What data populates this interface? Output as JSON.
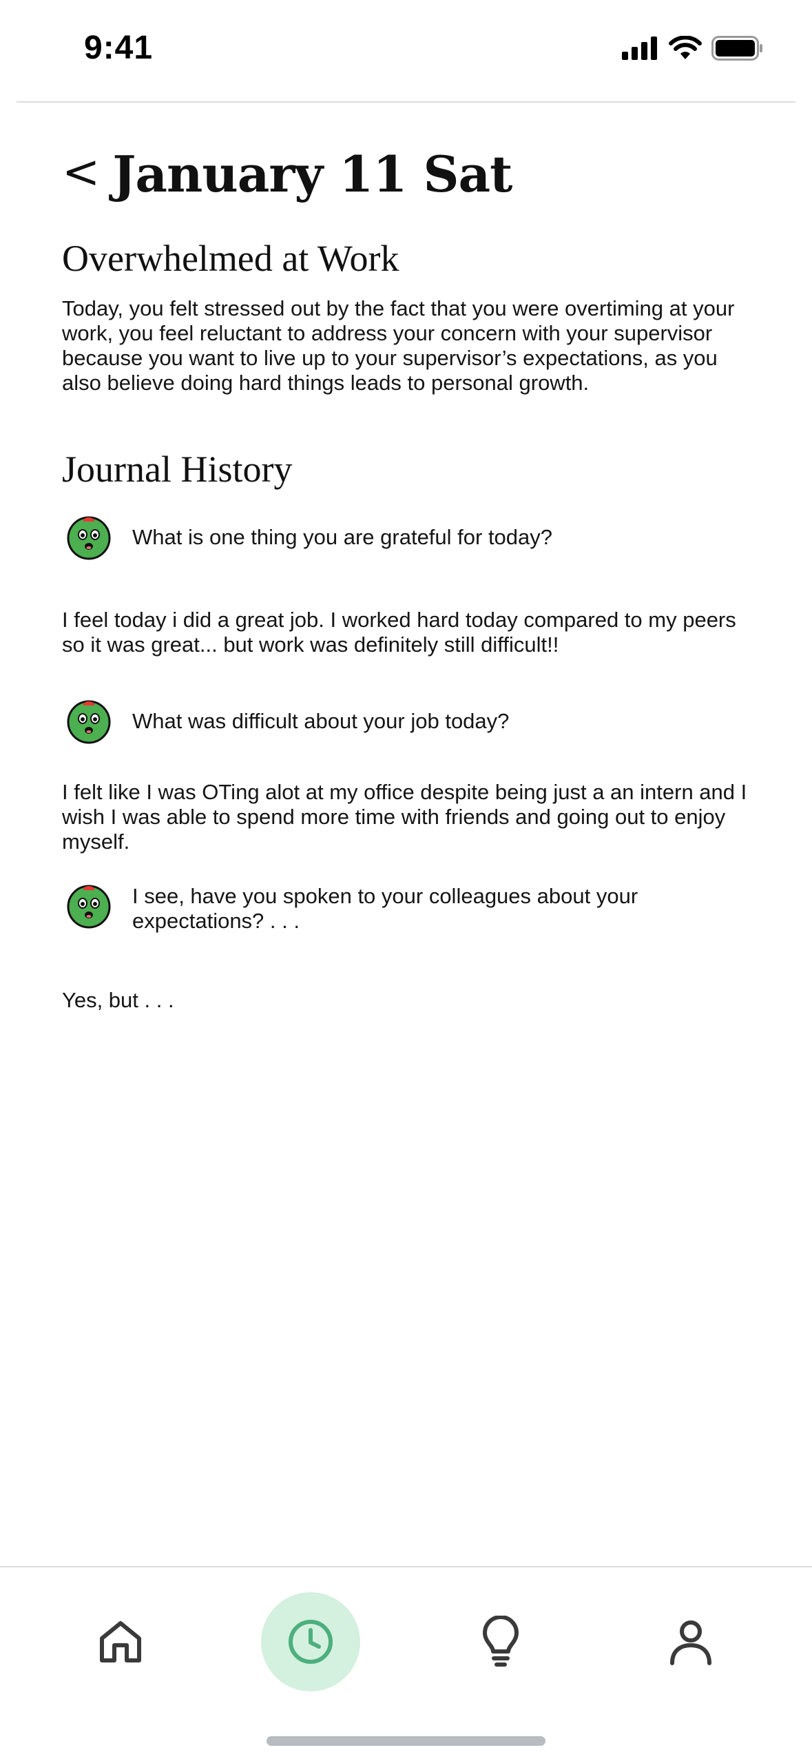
{
  "status_bar": {
    "time": "9:41"
  },
  "header": {
    "back_label": "<",
    "title": "January 11 Sat"
  },
  "entry": {
    "title": "Overwhelmed at Work",
    "summary": "Today, you felt stressed out by the fact that you were overtiming at your work, you feel reluctant to address your concern with your supervisor because you want to live up to your supervisor’s expectations, as you also believe doing hard things leads to personal growth."
  },
  "history": {
    "title": "Journal History",
    "items": [
      {
        "prompt": "What is one thing you are grateful for today?",
        "answer": "I feel today i did a great job. I worked hard today compared to my peers so it was great... but work was definitely still difficult!!"
      },
      {
        "prompt": "What was difficult about your job today?",
        "answer": "I felt like I was OTing alot at my office despite being just a an intern and I wish I was able to spend more time with friends and going out to enjoy myself."
      },
      {
        "prompt": "I see, have you spoken to your colleagues about your expectations? . . .",
        "answer": "Yes, but . . ."
      }
    ]
  },
  "tabbar": {
    "items": [
      {
        "icon": "home-icon",
        "active": false
      },
      {
        "icon": "clock-icon",
        "active": true
      },
      {
        "icon": "lightbulb-icon",
        "active": false
      },
      {
        "icon": "person-icon",
        "active": false
      }
    ]
  },
  "colors": {
    "accent": "#4caf7d",
    "accent_bg": "#d4f0df",
    "avatar_green": "#4caf50",
    "avatar_red": "#e53935"
  }
}
